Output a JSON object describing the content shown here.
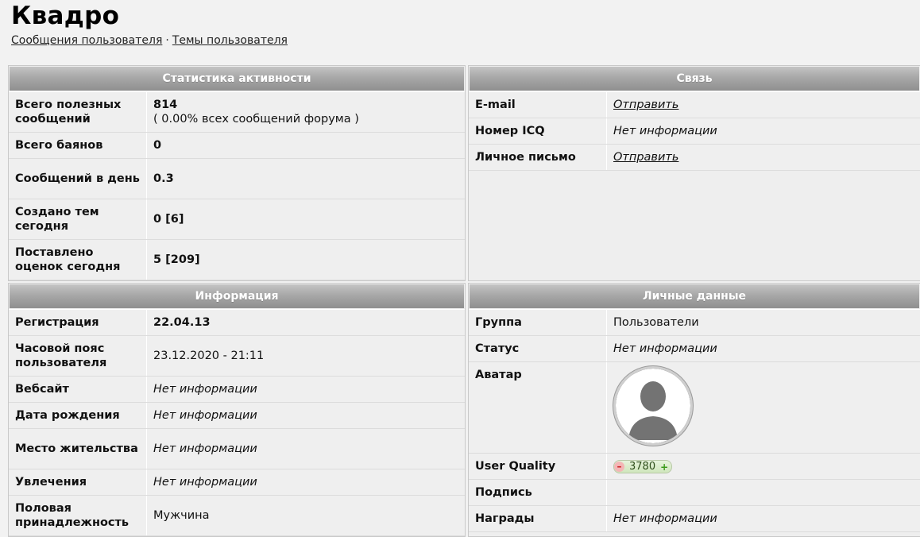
{
  "title": "Квадро",
  "nav": {
    "user_posts": "Сообщения пользователя",
    "separator": "·",
    "user_topics": "Темы пользователя"
  },
  "activity": {
    "header": "Статистика активности",
    "rows": [
      {
        "label": "Всего полезных сообщений",
        "value": "814",
        "sub": "( 0.00% всех сообщений форума )"
      },
      {
        "label": "Всего баянов",
        "value": "0"
      },
      {
        "label": "Сообщений в день",
        "value": "0.3"
      },
      {
        "label": "Создано тем сегодня",
        "value": "0 [6]"
      },
      {
        "label": "Поставлено оценок сегодня",
        "value": "5 [209]"
      }
    ]
  },
  "contact": {
    "header": "Связь",
    "rows": [
      {
        "label": "E-mail",
        "value": "Отправить"
      },
      {
        "label": "Номер ICQ",
        "value": "Нет информации"
      },
      {
        "label": "Личное письмо",
        "value": "Отправить"
      }
    ]
  },
  "info": {
    "header": "Информация",
    "rows": [
      {
        "label": "Регистрация",
        "value": "22.04.13"
      },
      {
        "label": "Часовой пояс пользователя",
        "value": "23.12.2020 - 21:11"
      },
      {
        "label": "Вебсайт",
        "value": "Нет информации"
      },
      {
        "label": "Дата рождения",
        "value": "Нет информации"
      },
      {
        "label": "Место жительства",
        "value": "Нет информации"
      },
      {
        "label": "Увлечения",
        "value": "Нет информации"
      },
      {
        "label": "Половая принадлежность",
        "value": "Мужчина"
      }
    ]
  },
  "personal": {
    "header": "Личные данные",
    "rows": [
      {
        "label": "Группа",
        "value": "Пользователи"
      },
      {
        "label": "Статус",
        "value": "Нет информации"
      },
      {
        "label": "Аватар",
        "value": ""
      },
      {
        "label": "User Quality",
        "value": "3780",
        "minus": "–",
        "plus": "+"
      },
      {
        "label": "Подпись",
        "value": ""
      },
      {
        "label": "Награды",
        "value": "Нет информации"
      }
    ]
  }
}
